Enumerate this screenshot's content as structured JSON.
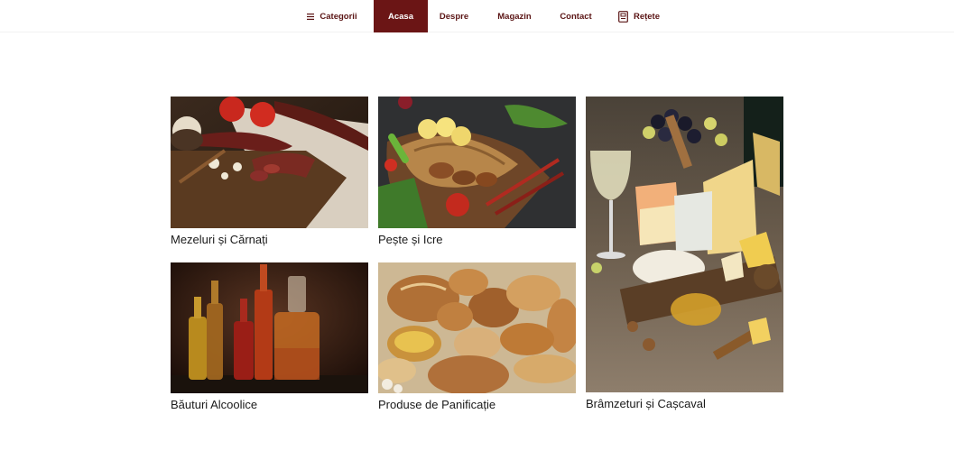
{
  "nav": {
    "items": [
      {
        "label": "Categorii",
        "icon": "menu-icon"
      },
      {
        "label": "Acasa",
        "active": true
      },
      {
        "label": "Despre"
      },
      {
        "label": "Magazin"
      },
      {
        "label": "Contact"
      },
      {
        "label": "Rețete",
        "icon": "recipe-book-icon"
      }
    ],
    "accent_color": "#6b1515"
  },
  "categories": [
    {
      "label": "Mezeluri și Cărnați",
      "image": "cured-meats-image"
    },
    {
      "label": "Pește și Icre",
      "image": "fish-platter-image"
    },
    {
      "label": "Brâmzeturi și Cașcaval",
      "image": "cheese-board-image"
    },
    {
      "label": "Băuturi Alcoolice",
      "image": "liquor-bottles-image"
    },
    {
      "label": "Produse de Panificație",
      "image": "bread-assortment-image"
    }
  ]
}
